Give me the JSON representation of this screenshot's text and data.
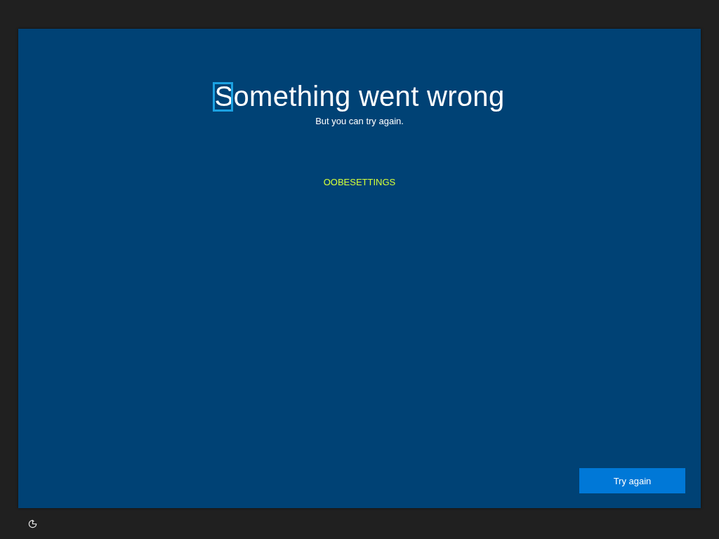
{
  "title": {
    "text": "Something went wrong",
    "first_letter_highlighted": true
  },
  "subtitle": "But you can try again.",
  "error_code": "OOBESETTINGS",
  "buttons": [
    {
      "label": "Try again"
    }
  ]
}
